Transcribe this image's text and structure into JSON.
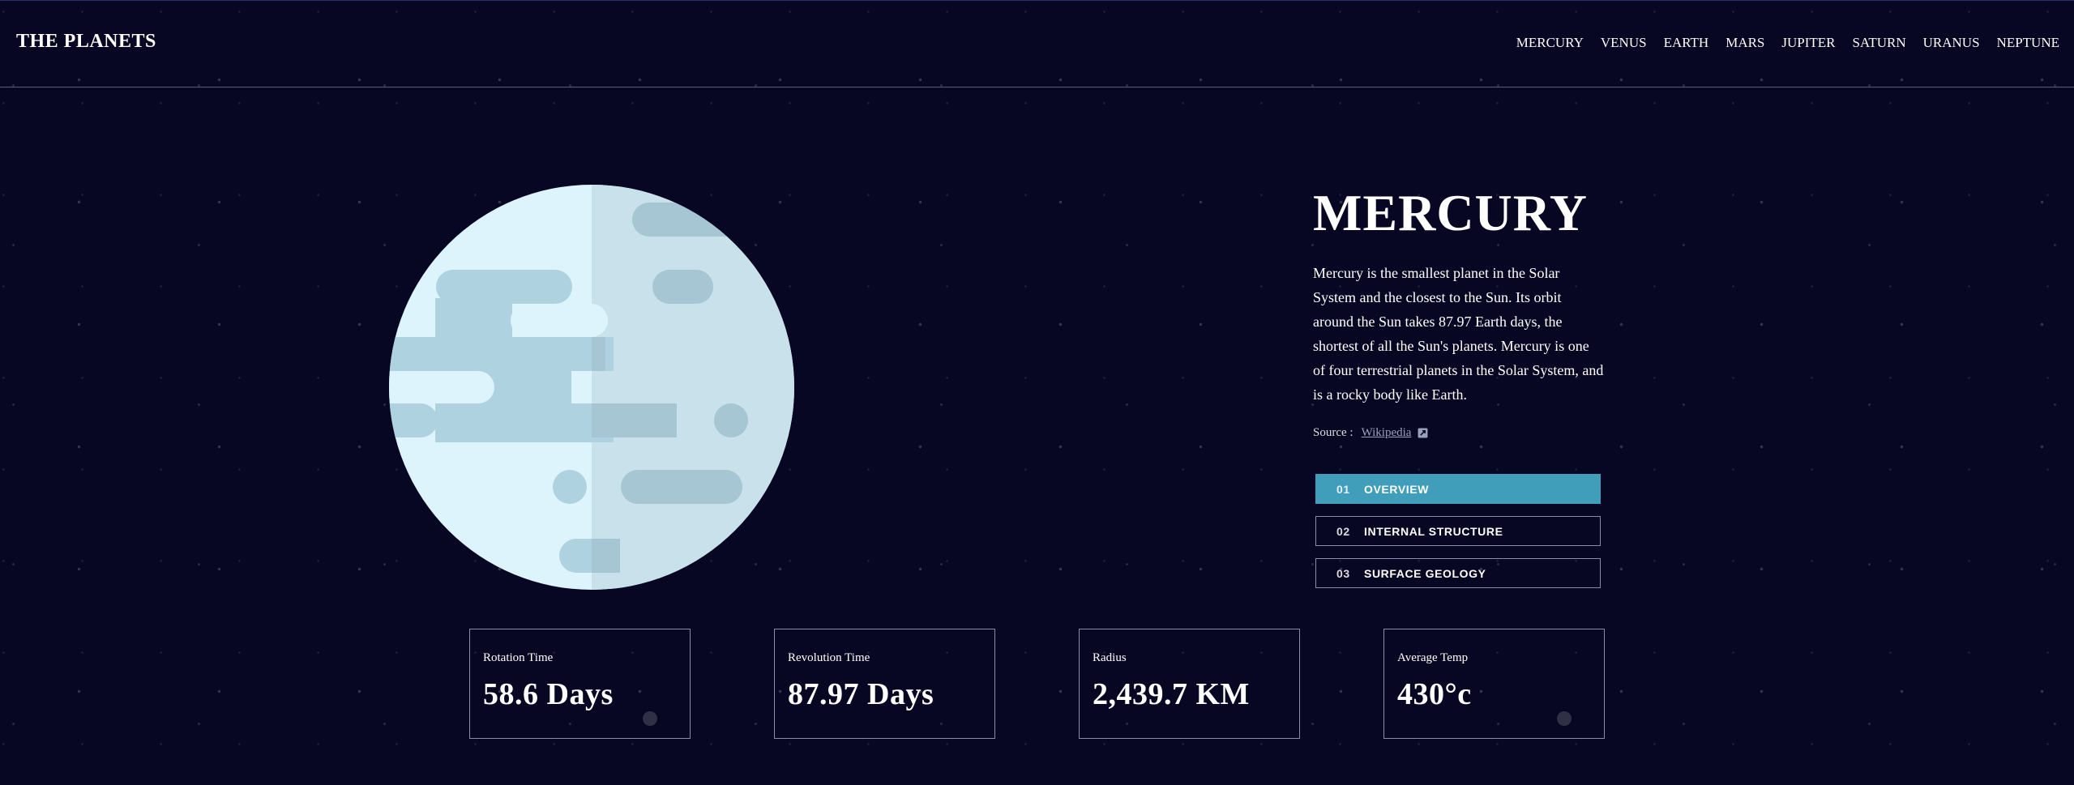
{
  "header": {
    "logo": "THE PLANETS",
    "nav": [
      "MERCURY",
      "VENUS",
      "EARTH",
      "MARS",
      "JUPITER",
      "SATURN",
      "URANUS",
      "NEPTUNE"
    ]
  },
  "planet": {
    "name": "MERCURY",
    "description": "Mercury is the smallest planet in the Solar System and the closest to the Sun. Its orbit around the Sun takes 87.97 Earth days, the shortest of all the Sun's planets. Mercury is one of four terrestrial planets in the Solar System, and is a rocky body like Earth.",
    "source_label": "Source :",
    "source_link": "Wikipedia",
    "source_icon": "external-link-icon",
    "colors": {
      "surface_light": "#def4fc",
      "surface_shadow": "#c9e1ea",
      "spots": "#afd2e0",
      "spots_shadow": "#a6c6d3"
    }
  },
  "tabs": [
    {
      "num": "01",
      "label": "OVERVIEW",
      "active": true
    },
    {
      "num": "02",
      "label": "INTERNAL STRUCTURE",
      "active": false
    },
    {
      "num": "03",
      "label": "SURFACE GEOLOGY",
      "active": false
    }
  ],
  "stats": [
    {
      "label": "Rotation Time",
      "value": "58.6 Days"
    },
    {
      "label": "Revolution Time",
      "value": "87.97 Days"
    },
    {
      "label": "Radius",
      "value": "2,439.7 KM"
    },
    {
      "label": "Average Temp",
      "value": "430°c"
    }
  ],
  "theme": {
    "background": "#070724",
    "accent": "#419ebb",
    "border": "#8a8ca6"
  }
}
